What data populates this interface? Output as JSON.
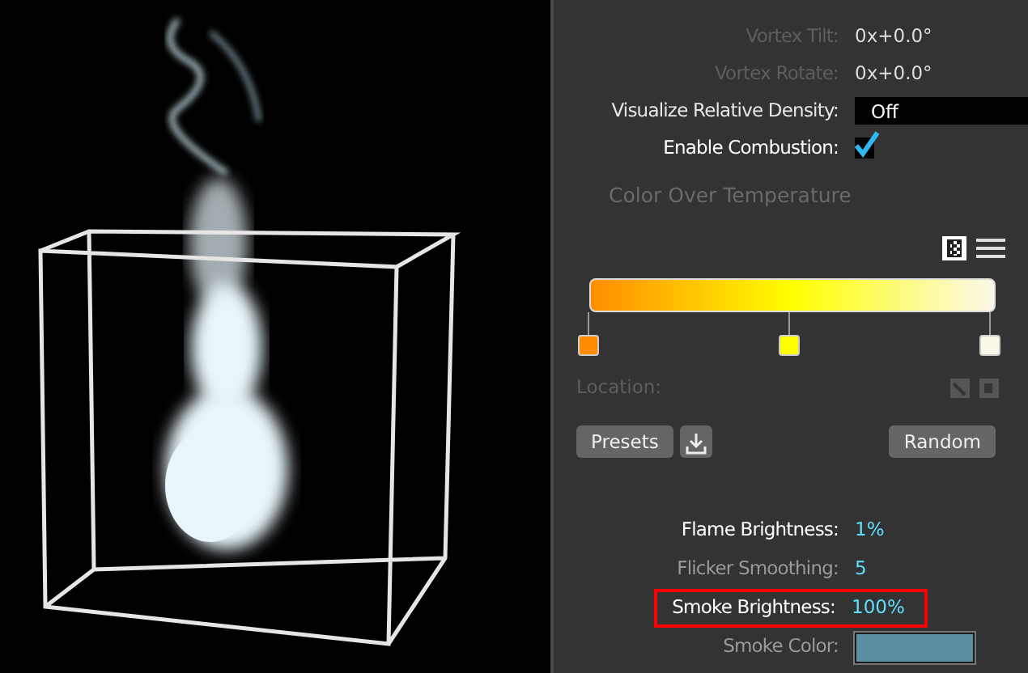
{
  "properties": [
    {
      "label": "Vortex Tilt:",
      "value": "0x+0.0°",
      "kind": "readout",
      "disabled": true
    },
    {
      "label": "Vortex Rotate:",
      "value": "0x+0.0°",
      "kind": "readout",
      "disabled": true
    },
    {
      "label": "Visualize Relative Density:",
      "value": "Off",
      "kind": "dropdown",
      "disabled": false
    },
    {
      "label": "Enable Combustion:",
      "kind": "checkbox",
      "checked": true,
      "disabled": false
    }
  ],
  "gradient_section": {
    "title": "Color Over Temperature",
    "stops": [
      {
        "color": "#ff8c00"
      },
      {
        "color": "#ffff00"
      },
      {
        "color": "#fbf8e9"
      }
    ],
    "location_label": "Location:",
    "buttons": {
      "presets": "Presets",
      "random": "Random"
    }
  },
  "combustion": [
    {
      "label": "Flame Brightness:",
      "value": "1%",
      "kind": "number",
      "disabled": false,
      "highlighted": false
    },
    {
      "label": "Flicker Smoothing:",
      "value": "5",
      "kind": "number",
      "disabled": true,
      "highlighted": false
    },
    {
      "label": "Smoke Brightness:",
      "value": "100%",
      "kind": "number",
      "disabled": false,
      "highlighted": true
    },
    {
      "label": "Smoke Color:",
      "kind": "color",
      "color": "#5b8fa3",
      "disabled": true,
      "highlighted": false
    }
  ]
}
